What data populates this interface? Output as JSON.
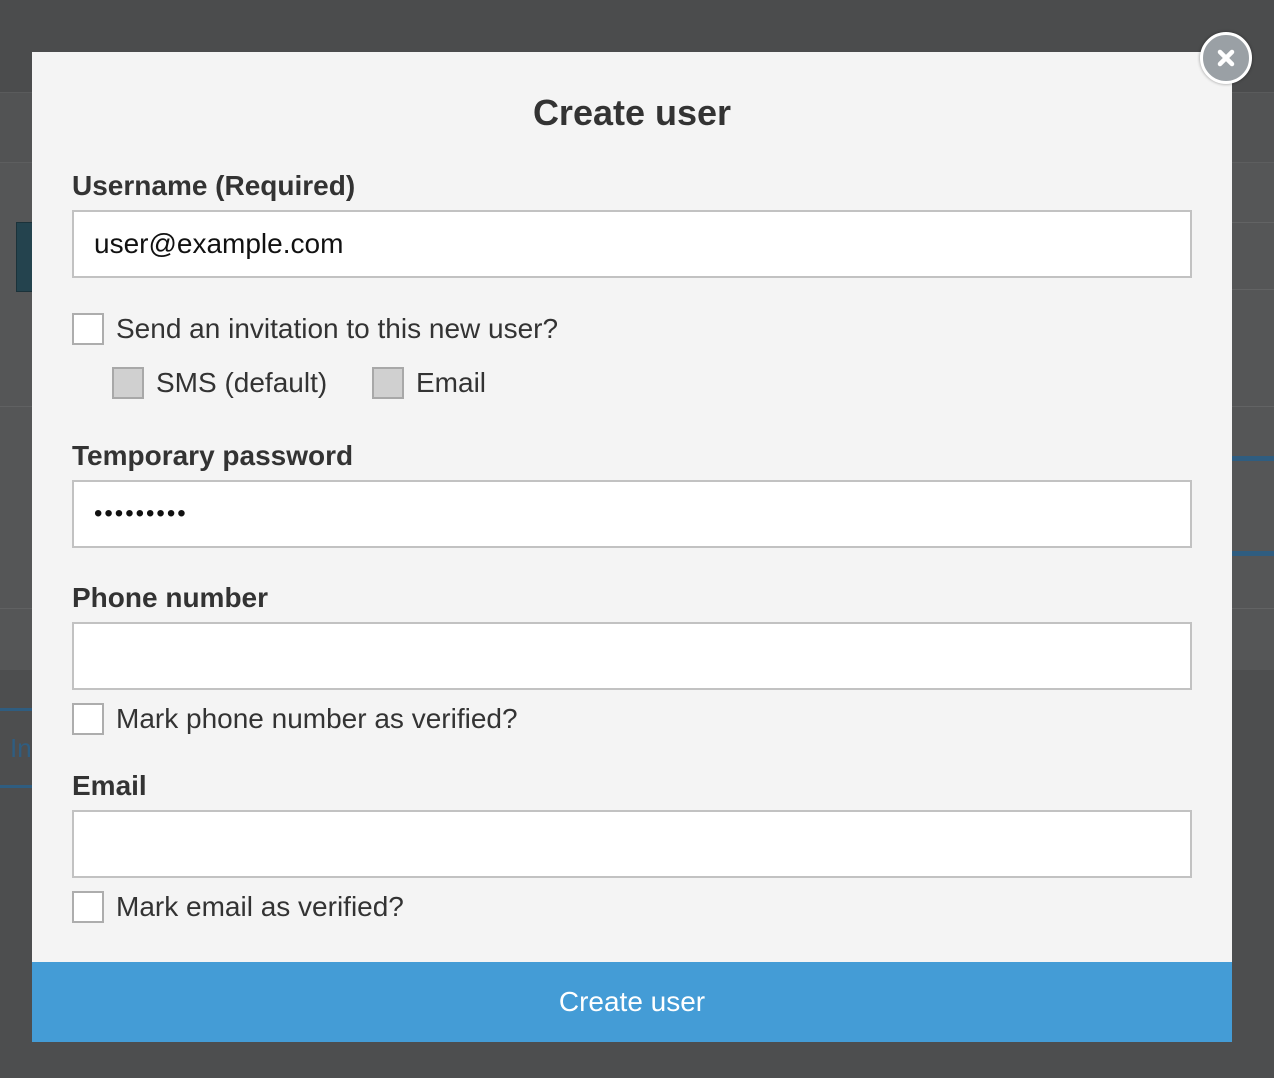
{
  "background": {
    "tab_fragment": "In"
  },
  "modal": {
    "title": "Create user",
    "close_icon": "close-icon",
    "username": {
      "label": "Username (Required)",
      "value": "user@example.com"
    },
    "invite": {
      "label": "Send an invitation to this new user?",
      "checked": false,
      "options": [
        {
          "label": "SMS (default)",
          "disabled": true
        },
        {
          "label": "Email",
          "disabled": true
        }
      ]
    },
    "temp_password": {
      "label": "Temporary password",
      "value": "password1"
    },
    "phone": {
      "label": "Phone number",
      "value": "",
      "verify_label": "Mark phone number as verified?"
    },
    "email": {
      "label": "Email",
      "value": "",
      "verify_label": "Mark email as verified?"
    },
    "submit_label": "Create user"
  },
  "colors": {
    "overlay": "#4d4e4f",
    "modal_bg": "#f4f4f4",
    "primary_button": "#449cd6",
    "text": "#333333",
    "input_border": "#c2c2c2"
  }
}
